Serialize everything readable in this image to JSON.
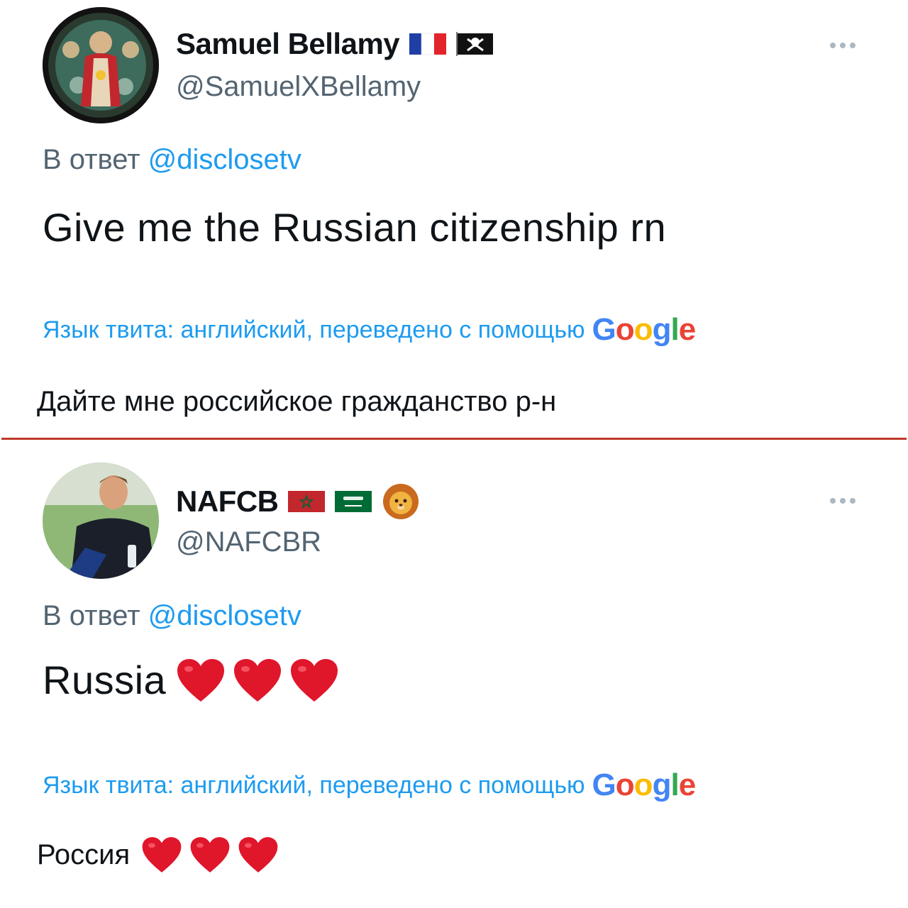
{
  "tweets": [
    {
      "display_name": "Samuel Bellamy",
      "flags": [
        "france-flag",
        "pirate-flag"
      ],
      "handle": "@SamuelXBellamy",
      "reply_prefix": "В ответ",
      "reply_to": "@disclosetv",
      "text": "Give me the Russian citizenship rn",
      "translation_note": "Язык твита: английский, переведено с помощью",
      "translation_provider": "Google",
      "translated_text": "Дайте мне российское гражданство р-н"
    },
    {
      "display_name": "NAFCB",
      "flags": [
        "morocco-flag",
        "saudi-arabia-flag",
        "lion-emoji"
      ],
      "handle": "@NAFCBR",
      "reply_prefix": "В ответ",
      "reply_to": "@disclosetv",
      "text": "Russia",
      "text_emoji": [
        "red-heart",
        "red-heart",
        "red-heart"
      ],
      "translation_note": "Язык твита: английский, переведено с помощью",
      "translation_provider": "Google",
      "translated_text": "Россия",
      "translated_emoji": [
        "red-heart",
        "red-heart",
        "red-heart"
      ]
    }
  ],
  "colors": {
    "link": "#1d9bf0",
    "secondary_text": "#536471",
    "divider": "#c0392b",
    "heart": "#e0162b"
  }
}
